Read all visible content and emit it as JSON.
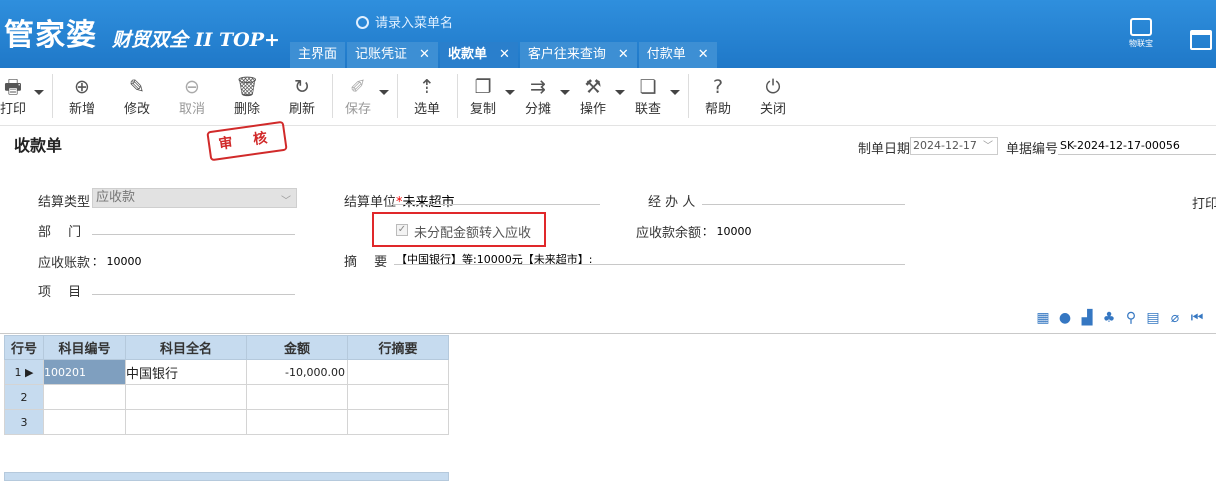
{
  "brand": {
    "logo": "管家婆",
    "sub": "财贸双全 II TOP+"
  },
  "search": {
    "placeholder": "请录入菜单名"
  },
  "tabs": [
    {
      "label": "主界面",
      "close": ""
    },
    {
      "label": "记账凭证",
      "close": "✕"
    },
    {
      "label": "收款单",
      "close": "✕"
    },
    {
      "label": "客户往来查询",
      "close": "✕"
    },
    {
      "label": "付款单",
      "close": "✕"
    }
  ],
  "wulianbao": "物联宝",
  "toolbar": {
    "print": "打印",
    "add": "新增",
    "edit": "修改",
    "cancel": "取消",
    "delete": "删除",
    "refresh": "刷新",
    "save": "保存",
    "select": "选单",
    "copy": "复制",
    "split": "分摊",
    "operate": "操作",
    "linkq": "联查",
    "help": "帮助",
    "close": "关闭"
  },
  "form": {
    "title": "收款单",
    "stamp": "审 核",
    "date_label": "制单日期",
    "date_value": "2024-12-17",
    "docno_label": "单据编号",
    "docno_value": "SK-2024-12-17-00056",
    "settle_type_label": "结算类型",
    "settle_type_value": "应收款",
    "settle_unit_label": "结算单位",
    "settle_unit_req": "*",
    "settle_unit_value": "未来超市",
    "handler_label": "经 办 人",
    "print_label": "打印",
    "dept_label": "部　 门",
    "checkbox_label": "未分配金额转入应收",
    "recv_balance_label": "应收款余额",
    "recv_balance_value": "： 10000",
    "recv_account_label": "应收账款",
    "recv_account_value": "： 10000",
    "summary_label": "摘　 要",
    "summary_value": "【中国银行】等:10000元【未来超市】:",
    "project_label": "项　 目"
  },
  "table": {
    "headers": [
      "行号",
      "科目编号",
      "科目全名",
      "金额",
      "行摘要"
    ],
    "rows": [
      {
        "no": "1",
        "code": "100201",
        "name": "中国银行",
        "amount": "-10,000.00",
        "memo": ""
      },
      {
        "no": "2",
        "code": "",
        "name": "",
        "amount": "",
        "memo": ""
      },
      {
        "no": "3",
        "code": "",
        "name": "",
        "amount": "",
        "memo": ""
      }
    ]
  }
}
